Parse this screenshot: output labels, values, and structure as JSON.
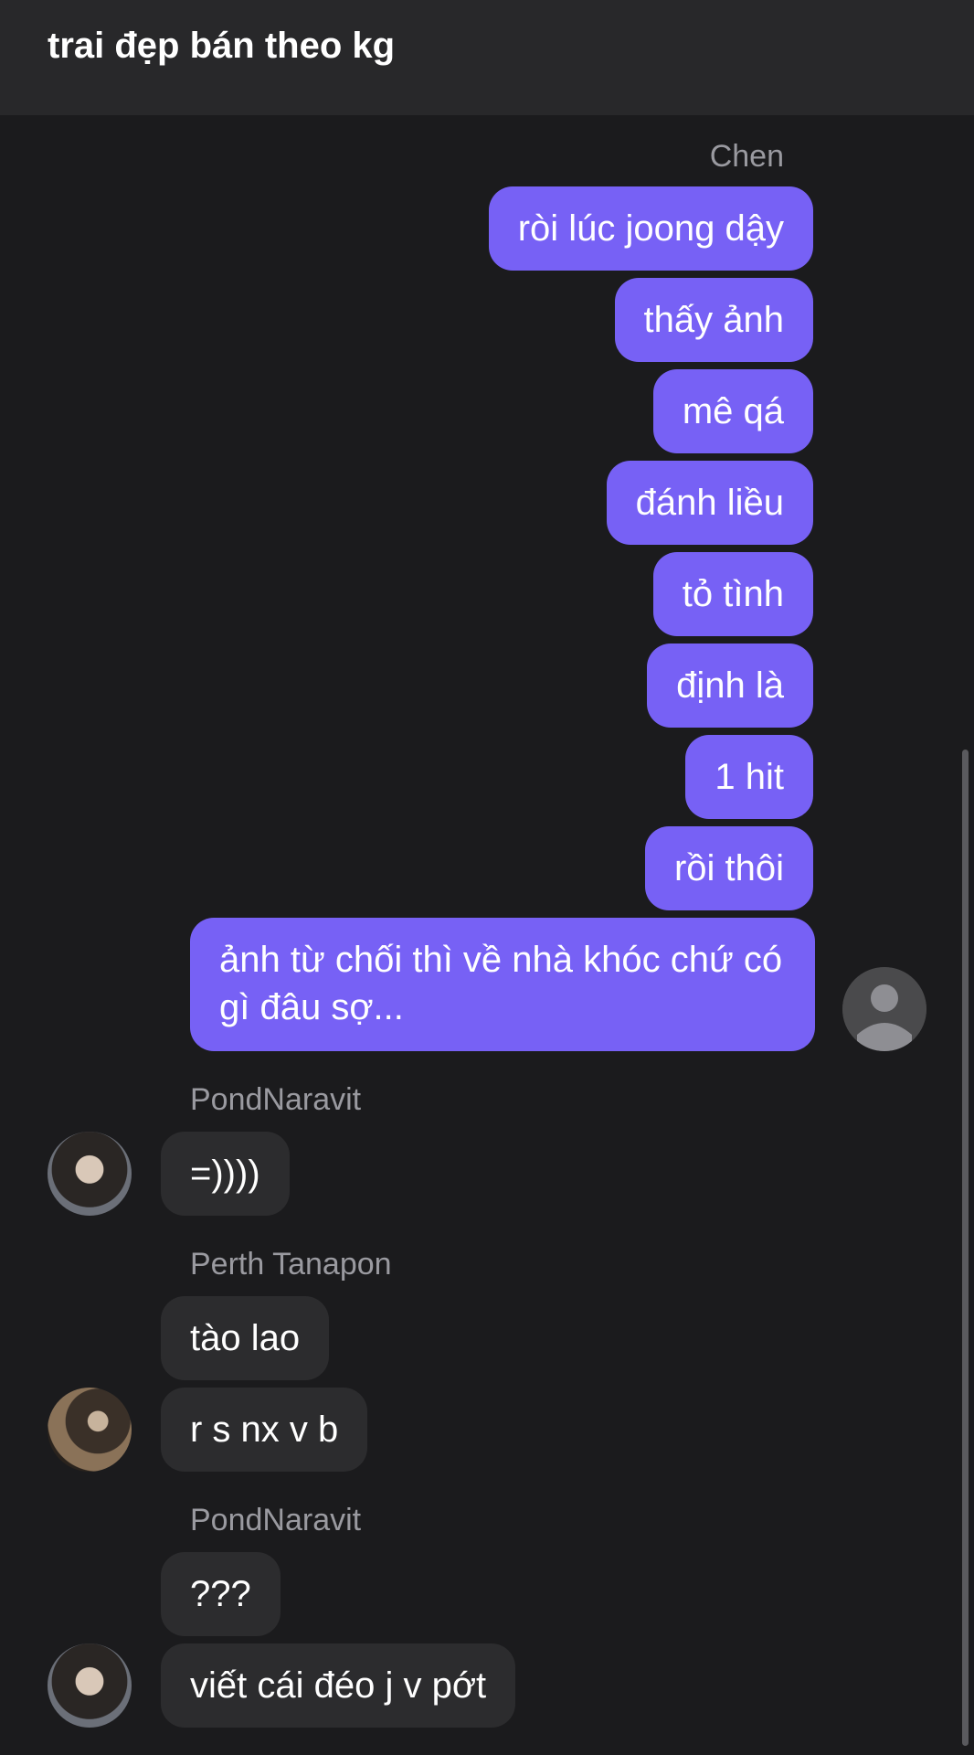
{
  "header": {
    "title": "trai đẹp bán theo kg"
  },
  "senders": {
    "chen": "Chen",
    "pond1": "PondNaravit",
    "perth": "Perth Tanapon",
    "pond2": "PondNaravit"
  },
  "outgoing": [
    "ròi lúc joong dậy",
    "thấy ảnh",
    "mê qá",
    "đánh liều",
    "tỏ tình",
    "định là",
    "1 hit",
    "rồi thôi",
    "ảnh từ chối thì về nhà khóc chứ có gì đâu sợ..."
  ],
  "incoming": {
    "pond1": [
      "=))))"
    ],
    "perth": [
      "tào lao",
      "r s nx v b"
    ],
    "pond2": [
      "???",
      "viết cái đéo j v pớt"
    ]
  },
  "colors": {
    "outgoing_bubble": "#7761f5",
    "incoming_bubble": "#2c2c2e",
    "background": "#1b1b1d"
  },
  "icons": {
    "default_avatar": "person-icon"
  }
}
